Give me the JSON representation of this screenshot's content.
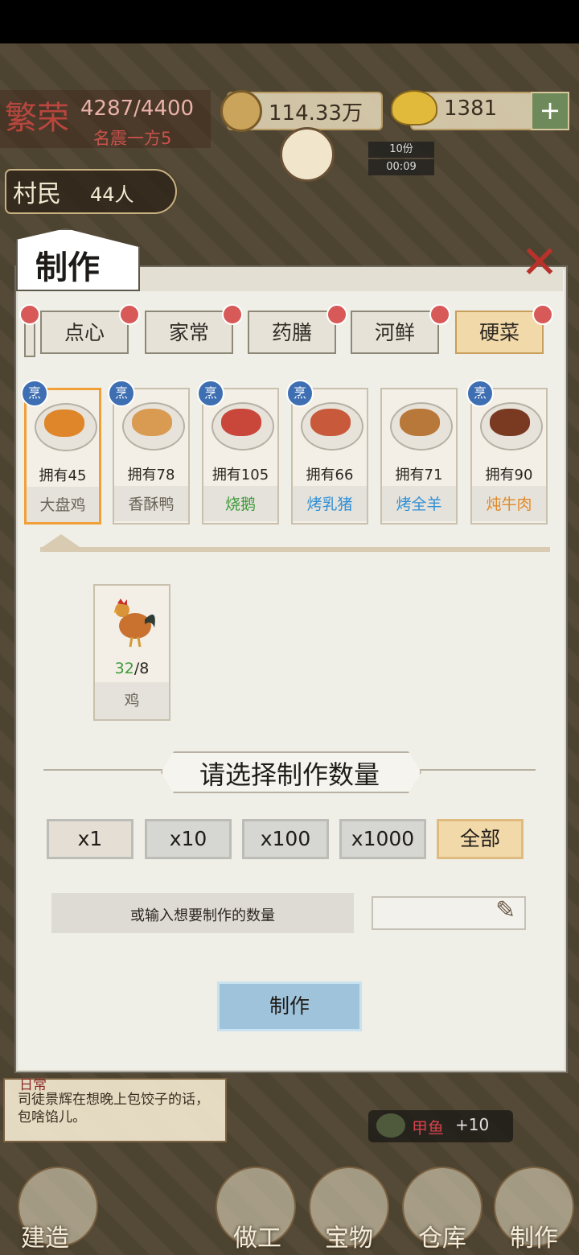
{
  "hud": {
    "prosperity_logo": "繁荣",
    "prosperity_value": "4287/4400",
    "prosperity_rank": "名震一方5",
    "copper": "114.33万",
    "gold": "1381",
    "add_symbol": "+",
    "event_count": "10份",
    "event_timer": "00:09",
    "villagers_label": "村民",
    "villagers_count": "44人"
  },
  "panel": {
    "title": "制作",
    "close_symbol": "✕",
    "categories": [
      {
        "label": "点心"
      },
      {
        "label": "家常"
      },
      {
        "label": "药膳"
      },
      {
        "label": "河鲜"
      },
      {
        "label": "硬菜",
        "active": true
      }
    ],
    "cook_badge": "烹",
    "recipes": [
      {
        "have": "拥有45",
        "name": "大盘鸡",
        "color": "#6a6358",
        "food_color": "#e0862a",
        "selected": true
      },
      {
        "have": "拥有78",
        "name": "香酥鸭",
        "color": "#6a6358",
        "food_color": "#d99a52"
      },
      {
        "have": "拥有105",
        "name": "烧鹅",
        "color": "#3e9a3a",
        "food_color": "#c9473a"
      },
      {
        "have": "拥有66",
        "name": "烤乳猪",
        "color": "#2f8fd6",
        "food_color": "#c8593a"
      },
      {
        "have": "拥有71",
        "name": "烤全羊",
        "color": "#2f8fd6",
        "food_color": "#b8783a"
      },
      {
        "have": "拥有90",
        "name": "炖牛肉",
        "color": "#e08a2a",
        "food_color": "#7a3a22"
      }
    ],
    "ingredient": {
      "have": "32",
      "need": "/8",
      "name": "鸡",
      "icon": "rooster-icon"
    },
    "quantity_title": "请选择制作数量",
    "quantity_buttons": [
      "x1",
      "x10",
      "x100",
      "x1000",
      "全部"
    ],
    "input_label": "或输入想要制作的数量",
    "input_value": "",
    "make_button": "制作"
  },
  "bottom": {
    "daily_tag": "日常",
    "daily_text": "司徒景辉在想晚上包饺子的话，包啥馅儿。",
    "reward_name": "甲鱼",
    "reward_value": "+10",
    "nav": [
      "建造",
      "做工",
      "宝物",
      "仓库",
      "制作"
    ]
  },
  "colors": {
    "accent_tab": "#f2d9a9",
    "make_button": "#9ec3da",
    "close": "#b8322b"
  }
}
